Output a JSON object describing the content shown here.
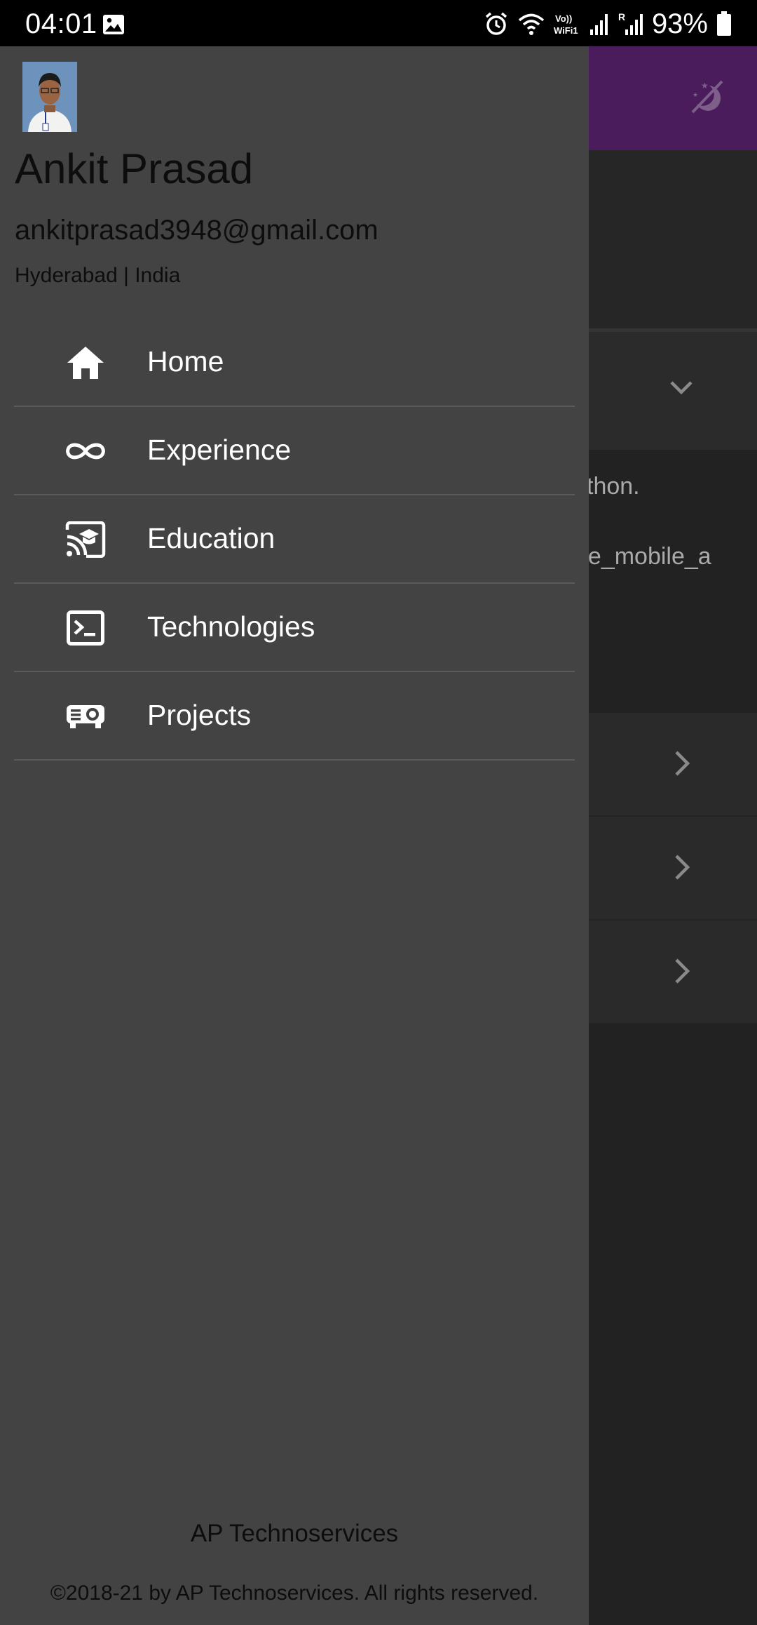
{
  "status_bar": {
    "time": "04:01",
    "battery": "93%",
    "icons": [
      "gallery-icon",
      "alarm-icon",
      "wifi-icon",
      "vowifi-icon",
      "signal-icon",
      "roaming-signal-icon",
      "battery-icon"
    ]
  },
  "background": {
    "appbar_color": "#4a1c5c",
    "expansion_label": "on",
    "text_line_1": "ython.",
    "text_line_2": "ne_mobile_a"
  },
  "drawer": {
    "user": {
      "name": "Ankit Prasad",
      "email": "ankitprasad3948@gmail.com",
      "location": "Hyderabad | India"
    },
    "menu": [
      {
        "label": "Home",
        "icon": "home-icon"
      },
      {
        "label": "Experience",
        "icon": "infinity-icon"
      },
      {
        "label": "Education",
        "icon": "cast-education-icon"
      },
      {
        "label": "Technologies",
        "icon": "terminal-icon"
      },
      {
        "label": "Projects",
        "icon": "projector-icon"
      }
    ],
    "footer": {
      "brand": "AP Technoservices",
      "copyright": "©2018-21 by AP Technoservices. All rights reserved."
    }
  }
}
